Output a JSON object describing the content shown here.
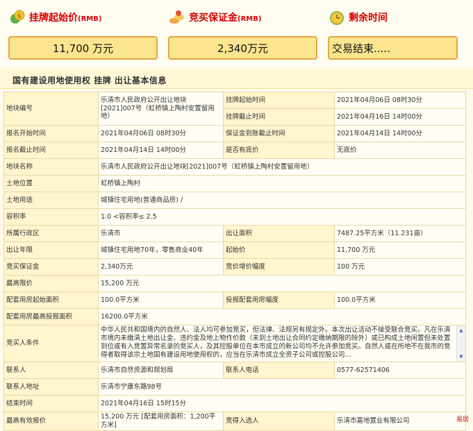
{
  "cards": {
    "start_price": {
      "title": "挂牌起始价",
      "unit": "(RMB)",
      "value": "11,700 万元"
    },
    "deposit": {
      "title": "竞买保证金",
      "unit": "(RMB)",
      "value": "2,340万元"
    },
    "time_left": {
      "title": "剩余时间",
      "value": "交易结束....."
    }
  },
  "section_title": "国有建设用地使用权 挂牌 出让基本信息",
  "rows": {
    "r1": {
      "l1": "地块编号",
      "v1": "乐清市人民政府公开出让地块[2021]007号（虹桥镇上陶村安置留用地）",
      "l2a": "挂牌起始时间",
      "v2a": "2021年04月06日 08时30分",
      "l2b": "挂牌截止时间",
      "v2b": "2021年04月16日 14时00分"
    },
    "r2": {
      "l1": "报名开始时间",
      "v1": "2021年04月06日 08时30分",
      "l2": "保证金到账截止时间",
      "v2": "2021年04月14日 14时00分"
    },
    "r3": {
      "l1": "报名截止时间",
      "v1": "2021年04月14日 14时00分",
      "l2": "是否有底价",
      "v2": "无底价"
    },
    "r4": {
      "l": "地块名称",
      "v": "乐清市人民政府公开出让地块[2021]007号（虹桥镇上陶村安置留用地）"
    },
    "r5": {
      "l": "土地位置",
      "v": "虹桥镇上陶村"
    },
    "r6": {
      "l": "土地用途",
      "v": "城镇住宅用地(普通商品房) /"
    },
    "r7": {
      "l": "容积率",
      "v": "1.0 <容积率≤ 2.5"
    },
    "r8": {
      "l1": "所属行政区",
      "v1": "乐清市",
      "l2": "出让面积",
      "v2": "7487.25平方米（11.231亩）"
    },
    "r9": {
      "l1": "出让年限",
      "v1": "城镇住宅用地70年，零售商业40年",
      "l2": "起始价",
      "v2": "11,700 万元"
    },
    "r10": {
      "l1": "竞买保证金",
      "v1": "2,340万元",
      "l2": "竞价增价幅度",
      "v2": "100 万元"
    },
    "r11": {
      "l": "最高限价",
      "v": "15,200 万元"
    },
    "r12": {
      "l1": "配套用房起始面积",
      "v1": "100.0平方米",
      "l2": "投报配套用房幅度",
      "v2": "100.0平方米"
    },
    "r13": {
      "l": "配套用房最高投报面积",
      "v": "16200.0平方米"
    },
    "r14": {
      "l": "竞买人条件",
      "v": "中华人民共和国境内的自然人、法人均可参加竞买，但法律、法规另有规定外。本次出让活动不接受联合竞买。凡在乐清市境内未缴清土地出让金、违约金及地上物作价款（未到土地出让合同约定缴纳期限的除外）或已构成土地闲置但未处置到位或有入竞置异常名录的竞买人，及其控股单位在本市成立的新公司均不允许参加竞买。自然人或在所地不在我市的竞得者取得该宗土地国有建设用地使用权的，应当在乐清市成立全资子公司或控股公司..."
    },
    "r15": {
      "l1": "联系人",
      "v1": "乐清市自然资源和规划局",
      "l2": "联系人电话",
      "v2": "0577-62571406"
    },
    "r16": {
      "l": "联系人地址",
      "v": "乐清市宁康东路98号"
    },
    "r17": {
      "l": "结束时间",
      "v": "2021年04月16日 15时15分"
    },
    "r18": {
      "l1": "最高有效报价",
      "v1": "15,200 万元 [配套用房面积：1,200平方米]",
      "l2": "竞得入选人",
      "v2": "乐清市嘉地置业有限公司"
    }
  },
  "watermark": "易居"
}
